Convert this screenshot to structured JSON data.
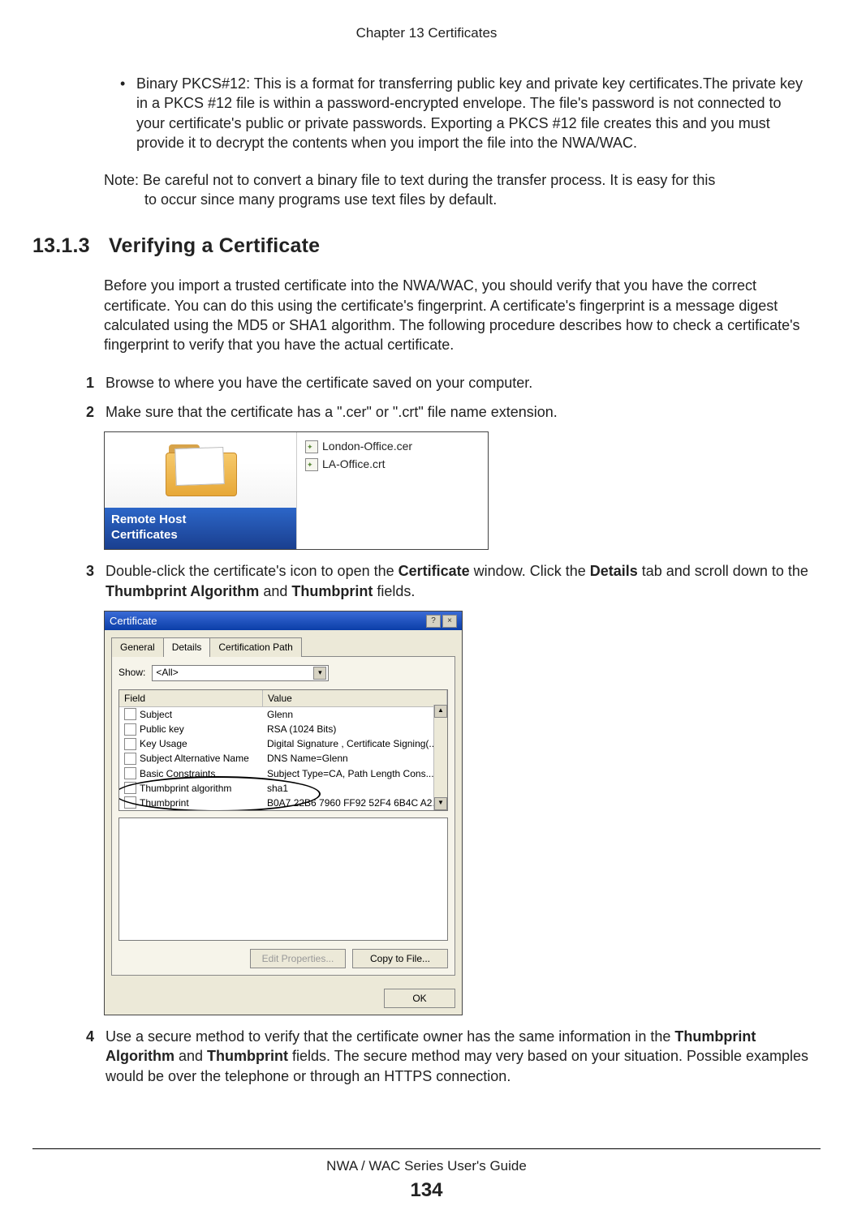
{
  "header": "Chapter 13 Certificates",
  "bullet": "Binary PKCS#12: This is a format for transferring public key and private key certificates.The private key in a PKCS #12 file is within a password-encrypted envelope. The file's password is not connected to your certificate's public or private passwords. Exporting a PKCS #12 file creates this and you must provide it to decrypt the contents when you import the file into the NWA/WAC.",
  "note_prefix": "Note: ",
  "note_body": "Be careful not to convert a binary file to text during the transfer process. It is easy for this to occur since many programs use text files by default.",
  "section": {
    "number": "13.1.3",
    "title": "Verifying a Certificate"
  },
  "intro": "Before you import a trusted certificate into the NWA/WAC, you should verify that you have the correct certificate. You can do this using the certificate's fingerprint. A certificate's fingerprint is a message digest calculated using the MD5 or SHA1 algorithm. The following procedure describes how to check a certificate's fingerprint to verify that you have the actual certificate.",
  "steps": {
    "s1": "Browse to where you have the certificate saved on your computer.",
    "s2": "Make sure that the certificate has a \".cer\" or \".crt\" file name extension.",
    "s3_a": "Double-click the certificate's icon to open the ",
    "s3_b": "Certificate",
    "s3_c": " window. Click the ",
    "s3_d": "Details",
    "s3_e": " tab and scroll down to the ",
    "s3_f": "Thumbprint Algorithm",
    "s3_g": " and ",
    "s3_h": "Thumbprint",
    "s3_i": " fields.",
    "s4_a": "Use a secure method to verify that the certificate owner has the same information in the ",
    "s4_b": "Thumbprint Algorithm",
    "s4_c": " and ",
    "s4_d": "Thumbprint",
    "s4_e": " fields. The secure method may very based on your situation. Possible examples would be over the telephone or through an HTTPS connection."
  },
  "step_numbers": {
    "n1": "1",
    "n2": "2",
    "n3": "3",
    "n4": "4"
  },
  "fig1": {
    "title_line1": "Remote Host",
    "title_line2": "Certificates",
    "file1": "London-Office.cer",
    "file2": "LA-Office.crt"
  },
  "fig2": {
    "title": "Certificate",
    "help_label": "?",
    "close_label": "×",
    "tabs": {
      "general": "General",
      "details": "Details",
      "certpath": "Certification Path"
    },
    "show_label": "Show:",
    "show_value": "<All>",
    "columns": {
      "field": "Field",
      "value": "Value"
    },
    "rows": [
      {
        "field": "Subject",
        "value": "Glenn"
      },
      {
        "field": "Public key",
        "value": "RSA (1024 Bits)"
      },
      {
        "field": "Key Usage",
        "value": "Digital Signature , Certificate Signing(..."
      },
      {
        "field": "Subject Alternative Name",
        "value": "DNS Name=Glenn"
      },
      {
        "field": "Basic Constraints",
        "value": "Subject Type=CA, Path Length Cons..."
      },
      {
        "field": "Thumbprint algorithm",
        "value": "sha1"
      },
      {
        "field": "Thumbprint",
        "value": "B0A7 22B6 7960 FF92 52F4 6B4C A2..."
      }
    ],
    "edit_btn": "Edit Properties...",
    "copy_btn": "Copy to File...",
    "ok_btn": "OK"
  },
  "footer": {
    "guide": "NWA / WAC Series User's Guide",
    "page": "134"
  }
}
